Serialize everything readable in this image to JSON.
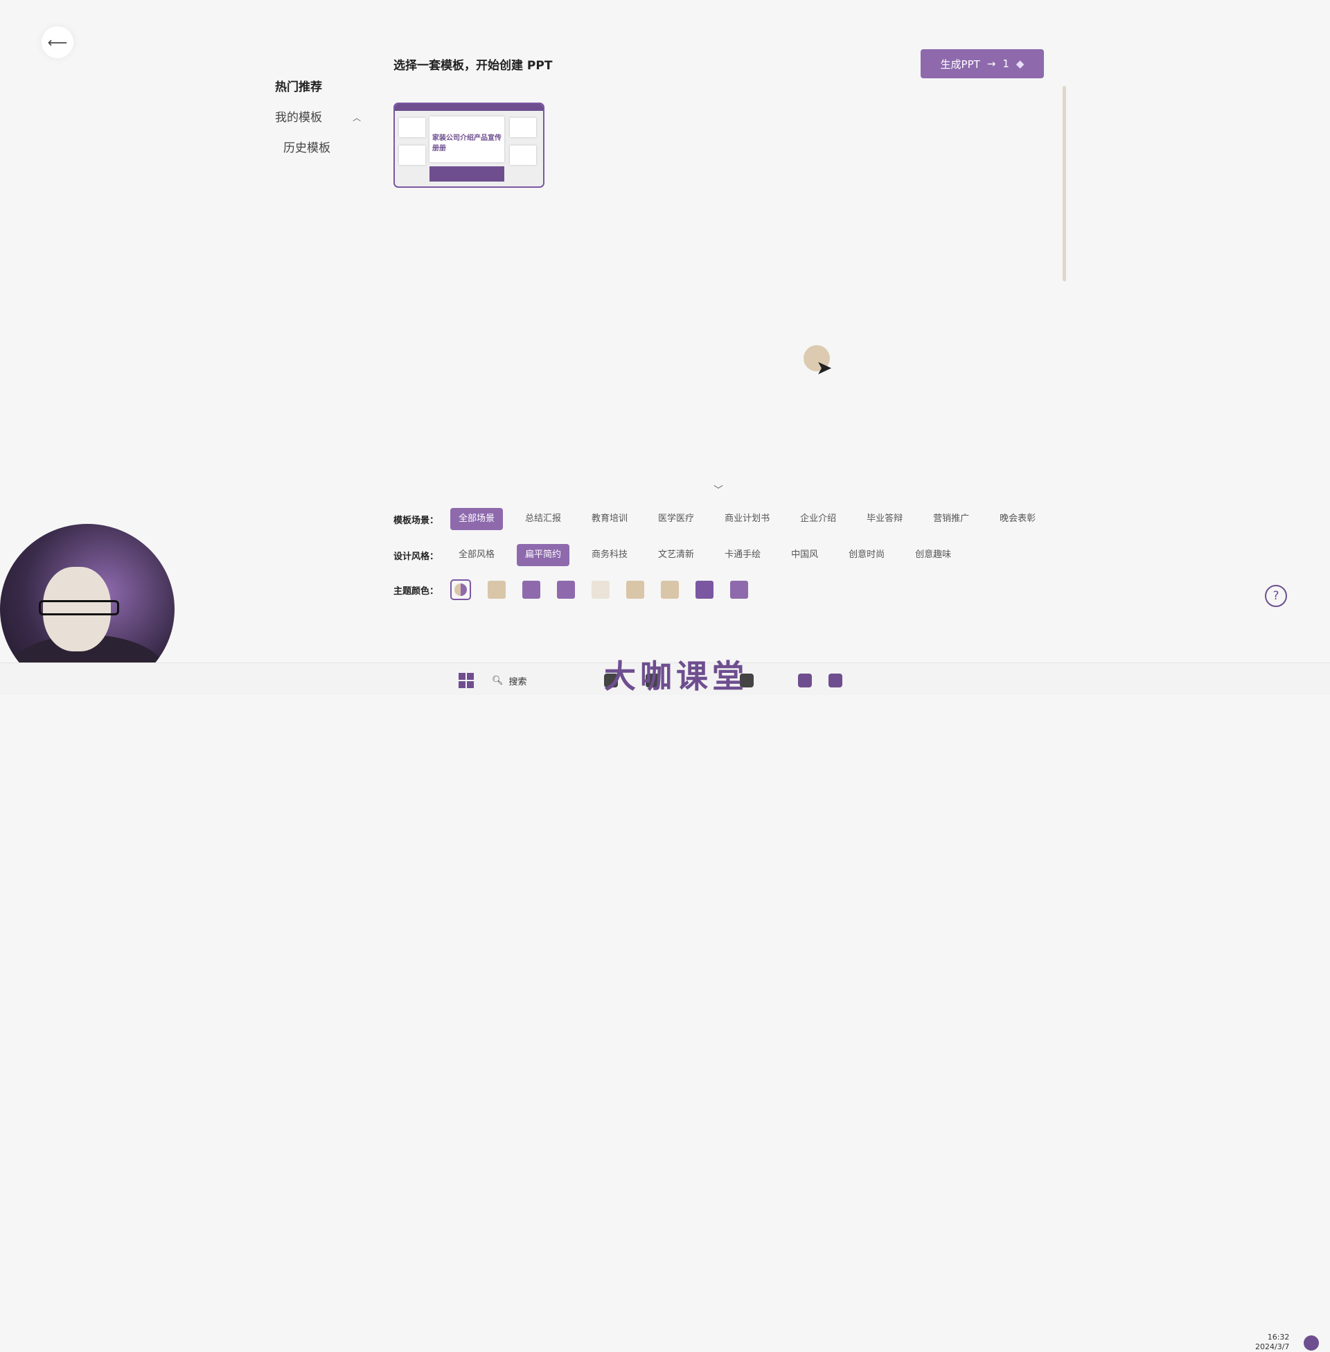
{
  "sidebar": {
    "items": [
      {
        "label": "热门推荐"
      },
      {
        "label": "我的模板"
      },
      {
        "label": "历史模板"
      }
    ]
  },
  "main": {
    "title": "选择一套模板，开始创建 PPT",
    "generate_button": {
      "label": "生成PPT",
      "arrow": "→",
      "count": "1"
    },
    "template_thumbnail": {
      "text": "家装公司介绍产品宣传册册"
    }
  },
  "filters": {
    "scene": {
      "label": "模板场景：",
      "options": [
        "全部场景",
        "总结汇报",
        "教育培训",
        "医学医疗",
        "商业计划书",
        "企业介绍",
        "毕业答辩",
        "营销推广",
        "晚会表彰"
      ],
      "selected": "全部场景"
    },
    "style": {
      "label": "设计风格：",
      "options": [
        "全部风格",
        "扁平简约",
        "商务科技",
        "文艺清新",
        "卡通手绘",
        "中国风",
        "创意时尚",
        "创意趣味"
      ],
      "selected": "扁平简约"
    },
    "color": {
      "label": "主题颜色：",
      "swatches": [
        "all",
        "#d9c6a8",
        "#8e6aad",
        "#8e6aad",
        "#ebe3d8",
        "#d9c6a8",
        "#d9c6a8",
        "#7b57a2",
        "#8e6aad"
      ]
    }
  },
  "taskbar": {
    "search": "搜索",
    "watermark": "大咖课堂",
    "time": "16:32",
    "date": "2024/3/7"
  },
  "colors": {
    "accent": "#8e6aad",
    "accent_dark": "#6e4e8f",
    "beige": "#d9c6a8"
  }
}
